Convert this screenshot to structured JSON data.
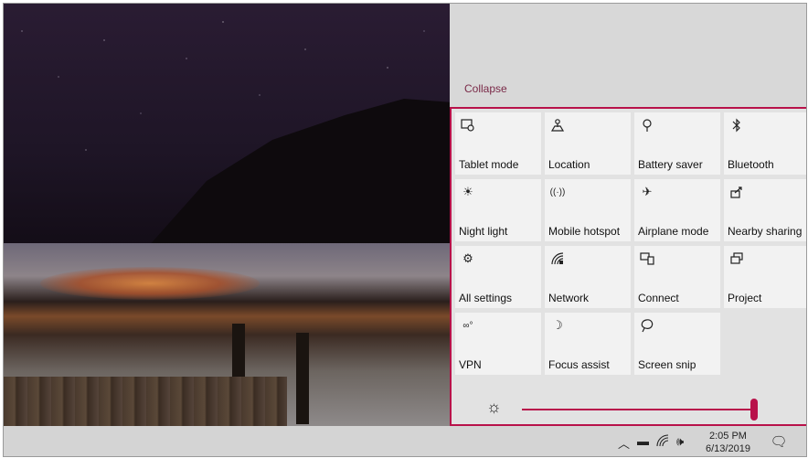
{
  "action_center": {
    "collapse_label": "Collapse",
    "tiles": [
      {
        "label": "Tablet mode",
        "icon": "tablet-mode-icon"
      },
      {
        "label": "Location",
        "icon": "location-icon"
      },
      {
        "label": "Battery saver",
        "icon": "battery-saver-icon"
      },
      {
        "label": "Bluetooth",
        "icon": "bluetooth-icon"
      },
      {
        "label": "Night light",
        "icon": "night-light-icon"
      },
      {
        "label": "Mobile hotspot",
        "icon": "mobile-hotspot-icon"
      },
      {
        "label": "Airplane mode",
        "icon": "airplane-mode-icon"
      },
      {
        "label": "Nearby sharing",
        "icon": "nearby-sharing-icon"
      },
      {
        "label": "All settings",
        "icon": "gear-icon"
      },
      {
        "label": "Network",
        "icon": "network-icon"
      },
      {
        "label": "Connect",
        "icon": "connect-icon"
      },
      {
        "label": "Project",
        "icon": "project-icon"
      },
      {
        "label": "VPN",
        "icon": "vpn-icon"
      },
      {
        "label": "Focus assist",
        "icon": "moon-icon"
      },
      {
        "label": "Screen snip",
        "icon": "screen-snip-icon"
      }
    ],
    "brightness_percent": 100,
    "accent_color": "#b8124a"
  },
  "taskbar": {
    "time": "2:05 PM",
    "date": "6/13/2019",
    "tray_icons": [
      "chevron-up-icon",
      "battery-icon",
      "wifi-icon",
      "volume-icon"
    ],
    "notification_icon": "notification-icon"
  }
}
